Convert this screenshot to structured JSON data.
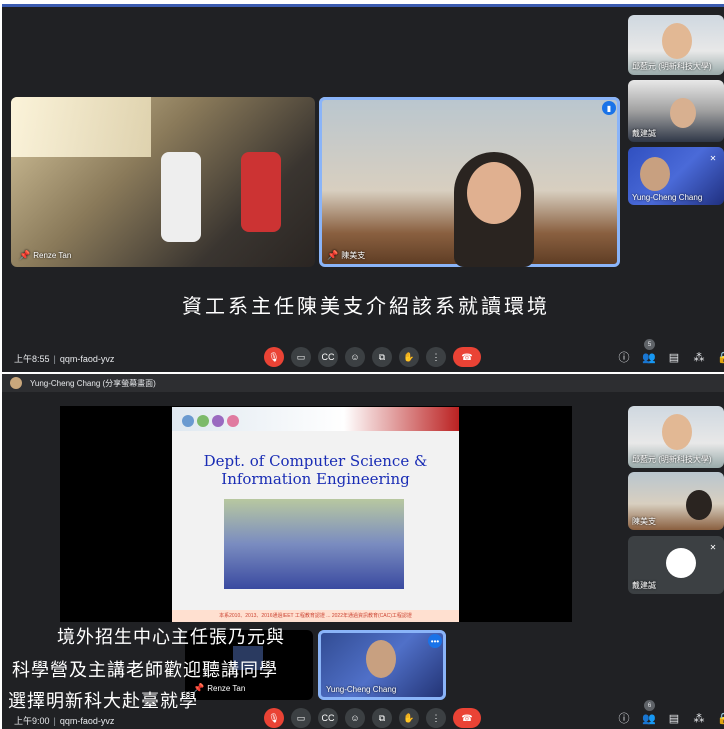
{
  "meeting1": {
    "tiles": [
      {
        "name": "Renze Tan"
      },
      {
        "name": "陳美支"
      }
    ],
    "side_tiles": [
      {
        "name": "邱藍元 (明新科技大學)"
      },
      {
        "name": "戴建誠"
      },
      {
        "name": "Yung-Cheng Chang"
      }
    ],
    "caption": "資工系主任陳美支介紹該系就讀環境",
    "time": "上午8:55",
    "code": "qqm-faod-yvz",
    "participants_count": "5"
  },
  "meeting2": {
    "presenter_label": "Yung-Cheng Chang (分享螢幕畫面)",
    "slide": {
      "title_line1": "Dept. of Computer Science &",
      "title_line2": "Information Engineering",
      "footer": "本系2010、2013、2016通過IEET 工程教育認證 ... 2022年通過資訊教育(CAC)工程認證"
    },
    "side_tiles": [
      {
        "name": "邱藍元 (明新科技大學)"
      },
      {
        "name": "陳美支"
      },
      {
        "name": "戴建誠"
      }
    ],
    "small_tiles": [
      {
        "name": "Renze Tan"
      },
      {
        "name": "Yung-Cheng Chang"
      }
    ],
    "caption_lines": [
      "境外招生中心主任張乃元與",
      "科學營及主講老師歡迎聽講同學",
      "選擇明新科大赴臺就學"
    ],
    "time": "上午9:00",
    "code": "qqm-faod-yvz",
    "participants_count": "6"
  },
  "colors": {
    "meet_bg": "#202124",
    "accent": "#8ab4f8",
    "end_call": "#ea4335"
  }
}
